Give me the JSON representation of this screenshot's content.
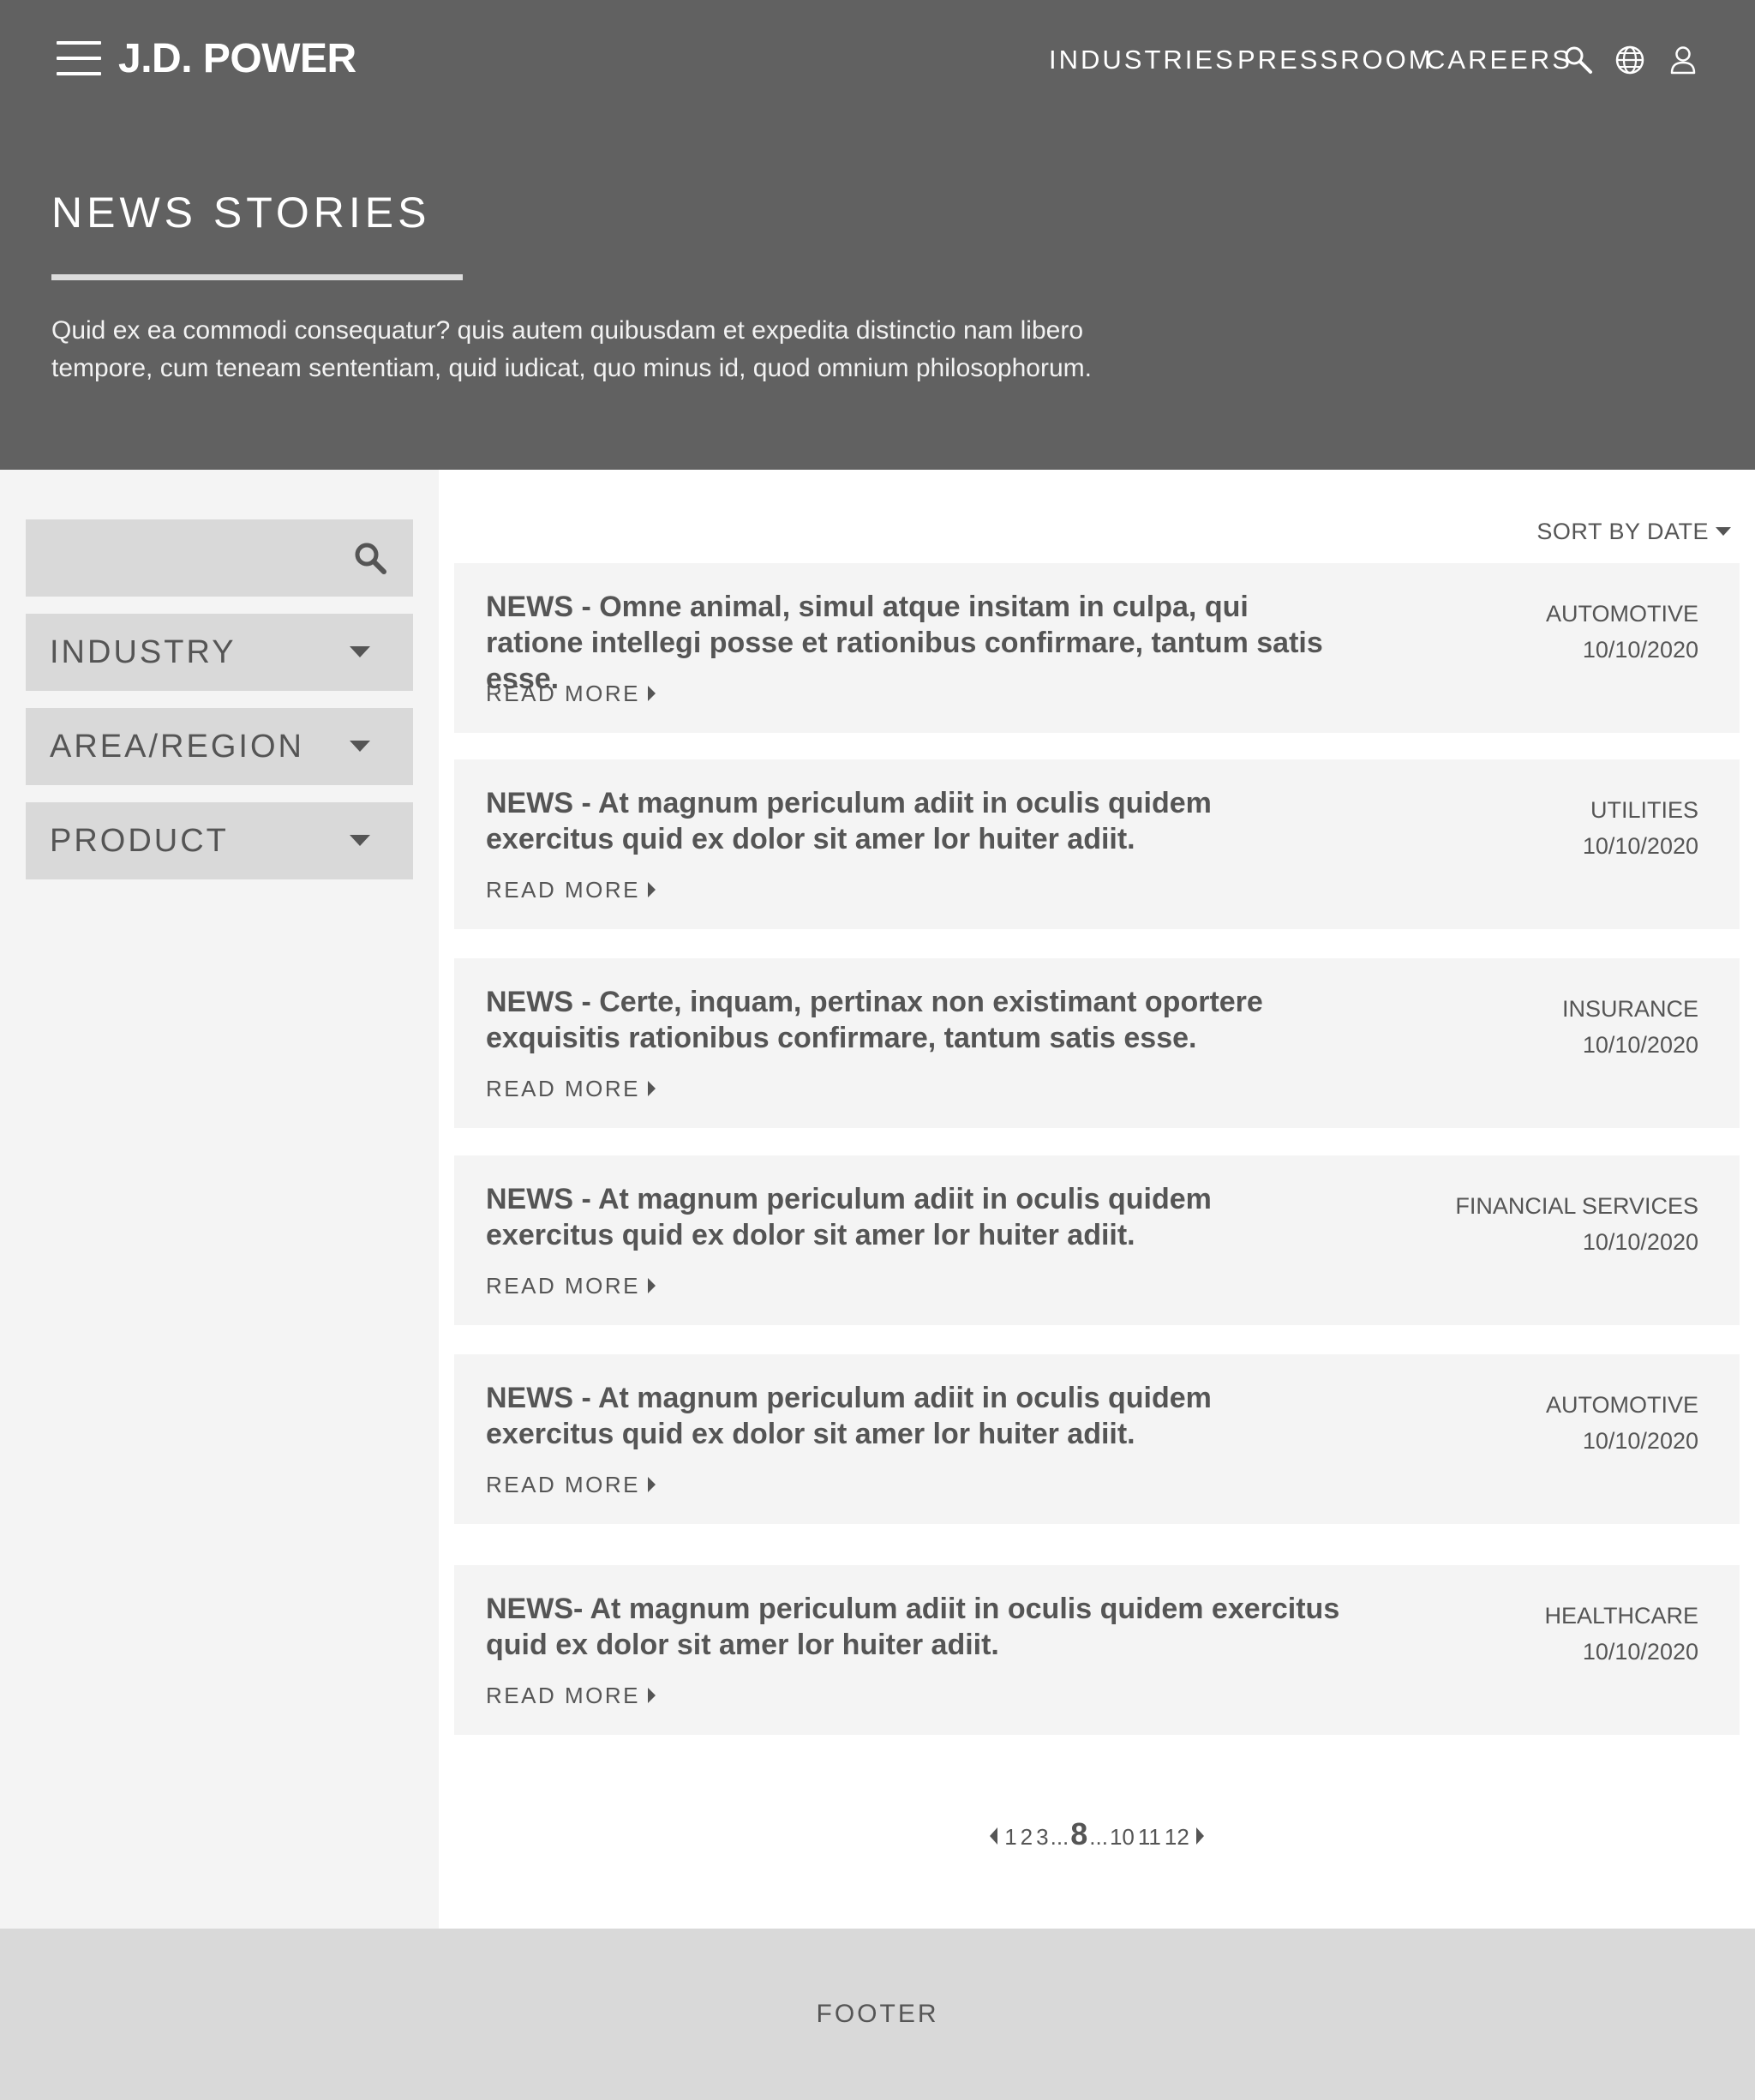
{
  "brand": {
    "logo_text": "J.D. POWER"
  },
  "nav": {
    "items": [
      {
        "label": "INDUSTRIES"
      },
      {
        "label": "PRESSROOM"
      },
      {
        "label": "CAREERS"
      }
    ],
    "icons": [
      "search-icon",
      "globe-icon",
      "user-icon"
    ]
  },
  "hero": {
    "title": "NEWS STORIES",
    "description": "Quid ex ea commodi consequatur? quis autem quibusdam et expedita distinctio nam libero tempore, cum teneam sententiam, quid iudicat, quo minus id, quod omnium philosophorum."
  },
  "sidebar": {
    "search": {
      "placeholder": "",
      "value": ""
    },
    "filters": [
      {
        "label": "INDUSTRY"
      },
      {
        "label": "AREA/REGION"
      },
      {
        "label": "PRODUCT"
      }
    ]
  },
  "sort": {
    "label": "SORT BY DATE"
  },
  "news": [
    {
      "title": "NEWS - Omne animal, simul atque insitam in culpa, qui ratione intellegi posse et rationibus confirmare, tantum satis esse.",
      "read_more": "READ MORE",
      "industry": "AUTOMOTIVE",
      "date": "10/10/2020"
    },
    {
      "title": "NEWS - At magnum periculum adiit in oculis quidem exercitus quid ex dolor sit amer lor huiter adiit.",
      "read_more": "READ MORE",
      "industry": "UTILITIES",
      "date": "10/10/2020"
    },
    {
      "title": "NEWS - Certe, inquam, pertinax non existimant oportere exquisitis rationibus confirmare, tantum satis esse.",
      "read_more": "READ MORE",
      "industry": "INSURANCE",
      "date": "10/10/2020"
    },
    {
      "title": "NEWS - At magnum periculum adiit in oculis quidem exercitus quid ex dolor sit amer lor huiter adiit.",
      "read_more": "READ MORE",
      "industry": "FINANCIAL SERVICES",
      "date": "10/10/2020"
    },
    {
      "title": "NEWS - At magnum periculum adiit in oculis quidem exercitus quid ex dolor sit amer lor huiter adiit.",
      "read_more": "READ MORE",
      "industry": "AUTOMOTIVE",
      "date": "10/10/2020"
    },
    {
      "title": "NEWS- At magnum periculum adiit in oculis quidem exercitus quid ex dolor sit amer lor huiter adiit.",
      "read_more": "READ MORE",
      "industry": "HEALTHCARE",
      "date": "10/10/2020"
    }
  ],
  "pagination": {
    "pages_start": [
      "1",
      "2",
      "3"
    ],
    "ellipsis_left": "...",
    "current": "8",
    "ellipsis_right": "...",
    "pages_end": [
      "10",
      "11",
      "12"
    ]
  },
  "footer": {
    "label": "FOOTER"
  },
  "colors": {
    "hero_bg": "#616161",
    "sidebar_bg": "#f4f4f4",
    "filter_bg": "#d9d9d9",
    "card_bg": "#f4f4f4",
    "footer_bg": "#d9d9d9",
    "text": "#555555"
  }
}
